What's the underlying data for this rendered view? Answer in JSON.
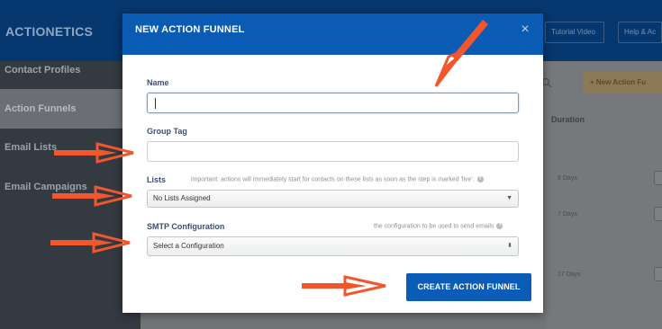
{
  "app": {
    "brand": "ACTIONETICS",
    "top_buttons": [
      "Tutorial Video",
      "Help & Ac"
    ],
    "sidebar": [
      {
        "label": "Contact Profiles",
        "active": false
      },
      {
        "label": "Action Funnels",
        "active": true
      },
      {
        "label": "Email Lists",
        "active": false
      },
      {
        "label": "Email Campaigns",
        "active": false
      }
    ],
    "add_button": "+ New Action Fu",
    "duration_header": "Duration",
    "duration_cells": [
      "8 Days",
      "7 Days",
      "17 Days"
    ]
  },
  "modal": {
    "title": "NEW ACTION FUNNEL",
    "close": "×",
    "name_label": "Name",
    "name_value": "",
    "group_tag_label": "Group Tag",
    "group_tag_value": "",
    "lists_label": "Lists",
    "lists_hint": "important: actions will immediately start for contacts on these lists as soon as the step is marked 'live'.",
    "lists_value": "No Lists Assigned",
    "smtp_label": "SMTP Configuration",
    "smtp_hint": "the configuration to be used to send emails",
    "smtp_value": "Select a Configuration",
    "submit_label": "CREATE ACTION FUNNEL"
  },
  "annotations": {
    "arrow_color": "#f2562c",
    "arrow_count": 5
  }
}
